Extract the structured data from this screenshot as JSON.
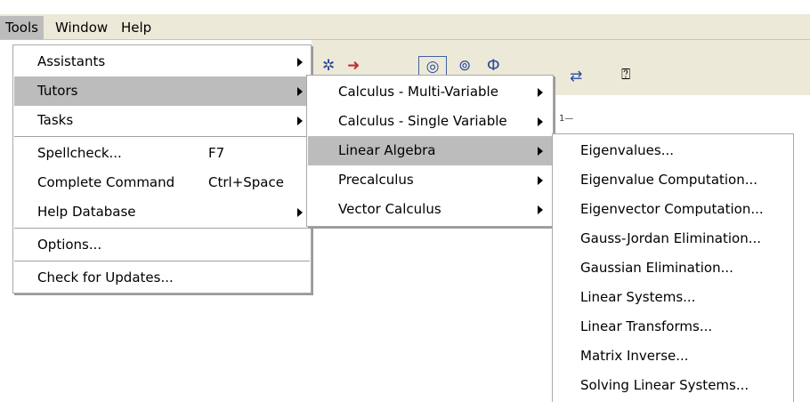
{
  "menubar": {
    "items": [
      {
        "label": "Tools"
      },
      {
        "label": "Window"
      },
      {
        "label": "Help"
      }
    ]
  },
  "tools_menu": {
    "items": [
      {
        "label": "Assistants",
        "accel": ""
      },
      {
        "label": "Tutors",
        "accel": ""
      },
      {
        "label": "Tasks",
        "accel": ""
      },
      {
        "label": "Spellcheck...",
        "accel": "F7"
      },
      {
        "label": "Complete Command",
        "accel": "Ctrl+Space"
      },
      {
        "label": "Help Database",
        "accel": ""
      },
      {
        "label": "Options...",
        "accel": ""
      },
      {
        "label": "Check for Updates...",
        "accel": ""
      }
    ]
  },
  "tutors_menu": {
    "items": [
      {
        "label": "Calculus - Multi-Variable"
      },
      {
        "label": "Calculus - Single Variable"
      },
      {
        "label": "Linear Algebra"
      },
      {
        "label": "Precalculus"
      },
      {
        "label": "Vector Calculus"
      }
    ]
  },
  "linear_algebra_menu": {
    "items": [
      {
        "label": "Eigenvalues..."
      },
      {
        "label": "Eigenvalue Computation..."
      },
      {
        "label": "Eigenvector Computation..."
      },
      {
        "label": "Gauss-Jordan Elimination..."
      },
      {
        "label": "Gaussian Elimination..."
      },
      {
        "label": "Linear Systems..."
      },
      {
        "label": "Linear Transforms..."
      },
      {
        "label": "Matrix Inverse..."
      },
      {
        "label": "Solving Linear Systems..."
      }
    ]
  },
  "toolbar": {
    "icons": [
      "plot-icon",
      "arrow-icon",
      "display-icon",
      "zoom-icon",
      "graph-icon",
      "swap-icon",
      "help-icon"
    ],
    "subscript_text": "1—"
  }
}
